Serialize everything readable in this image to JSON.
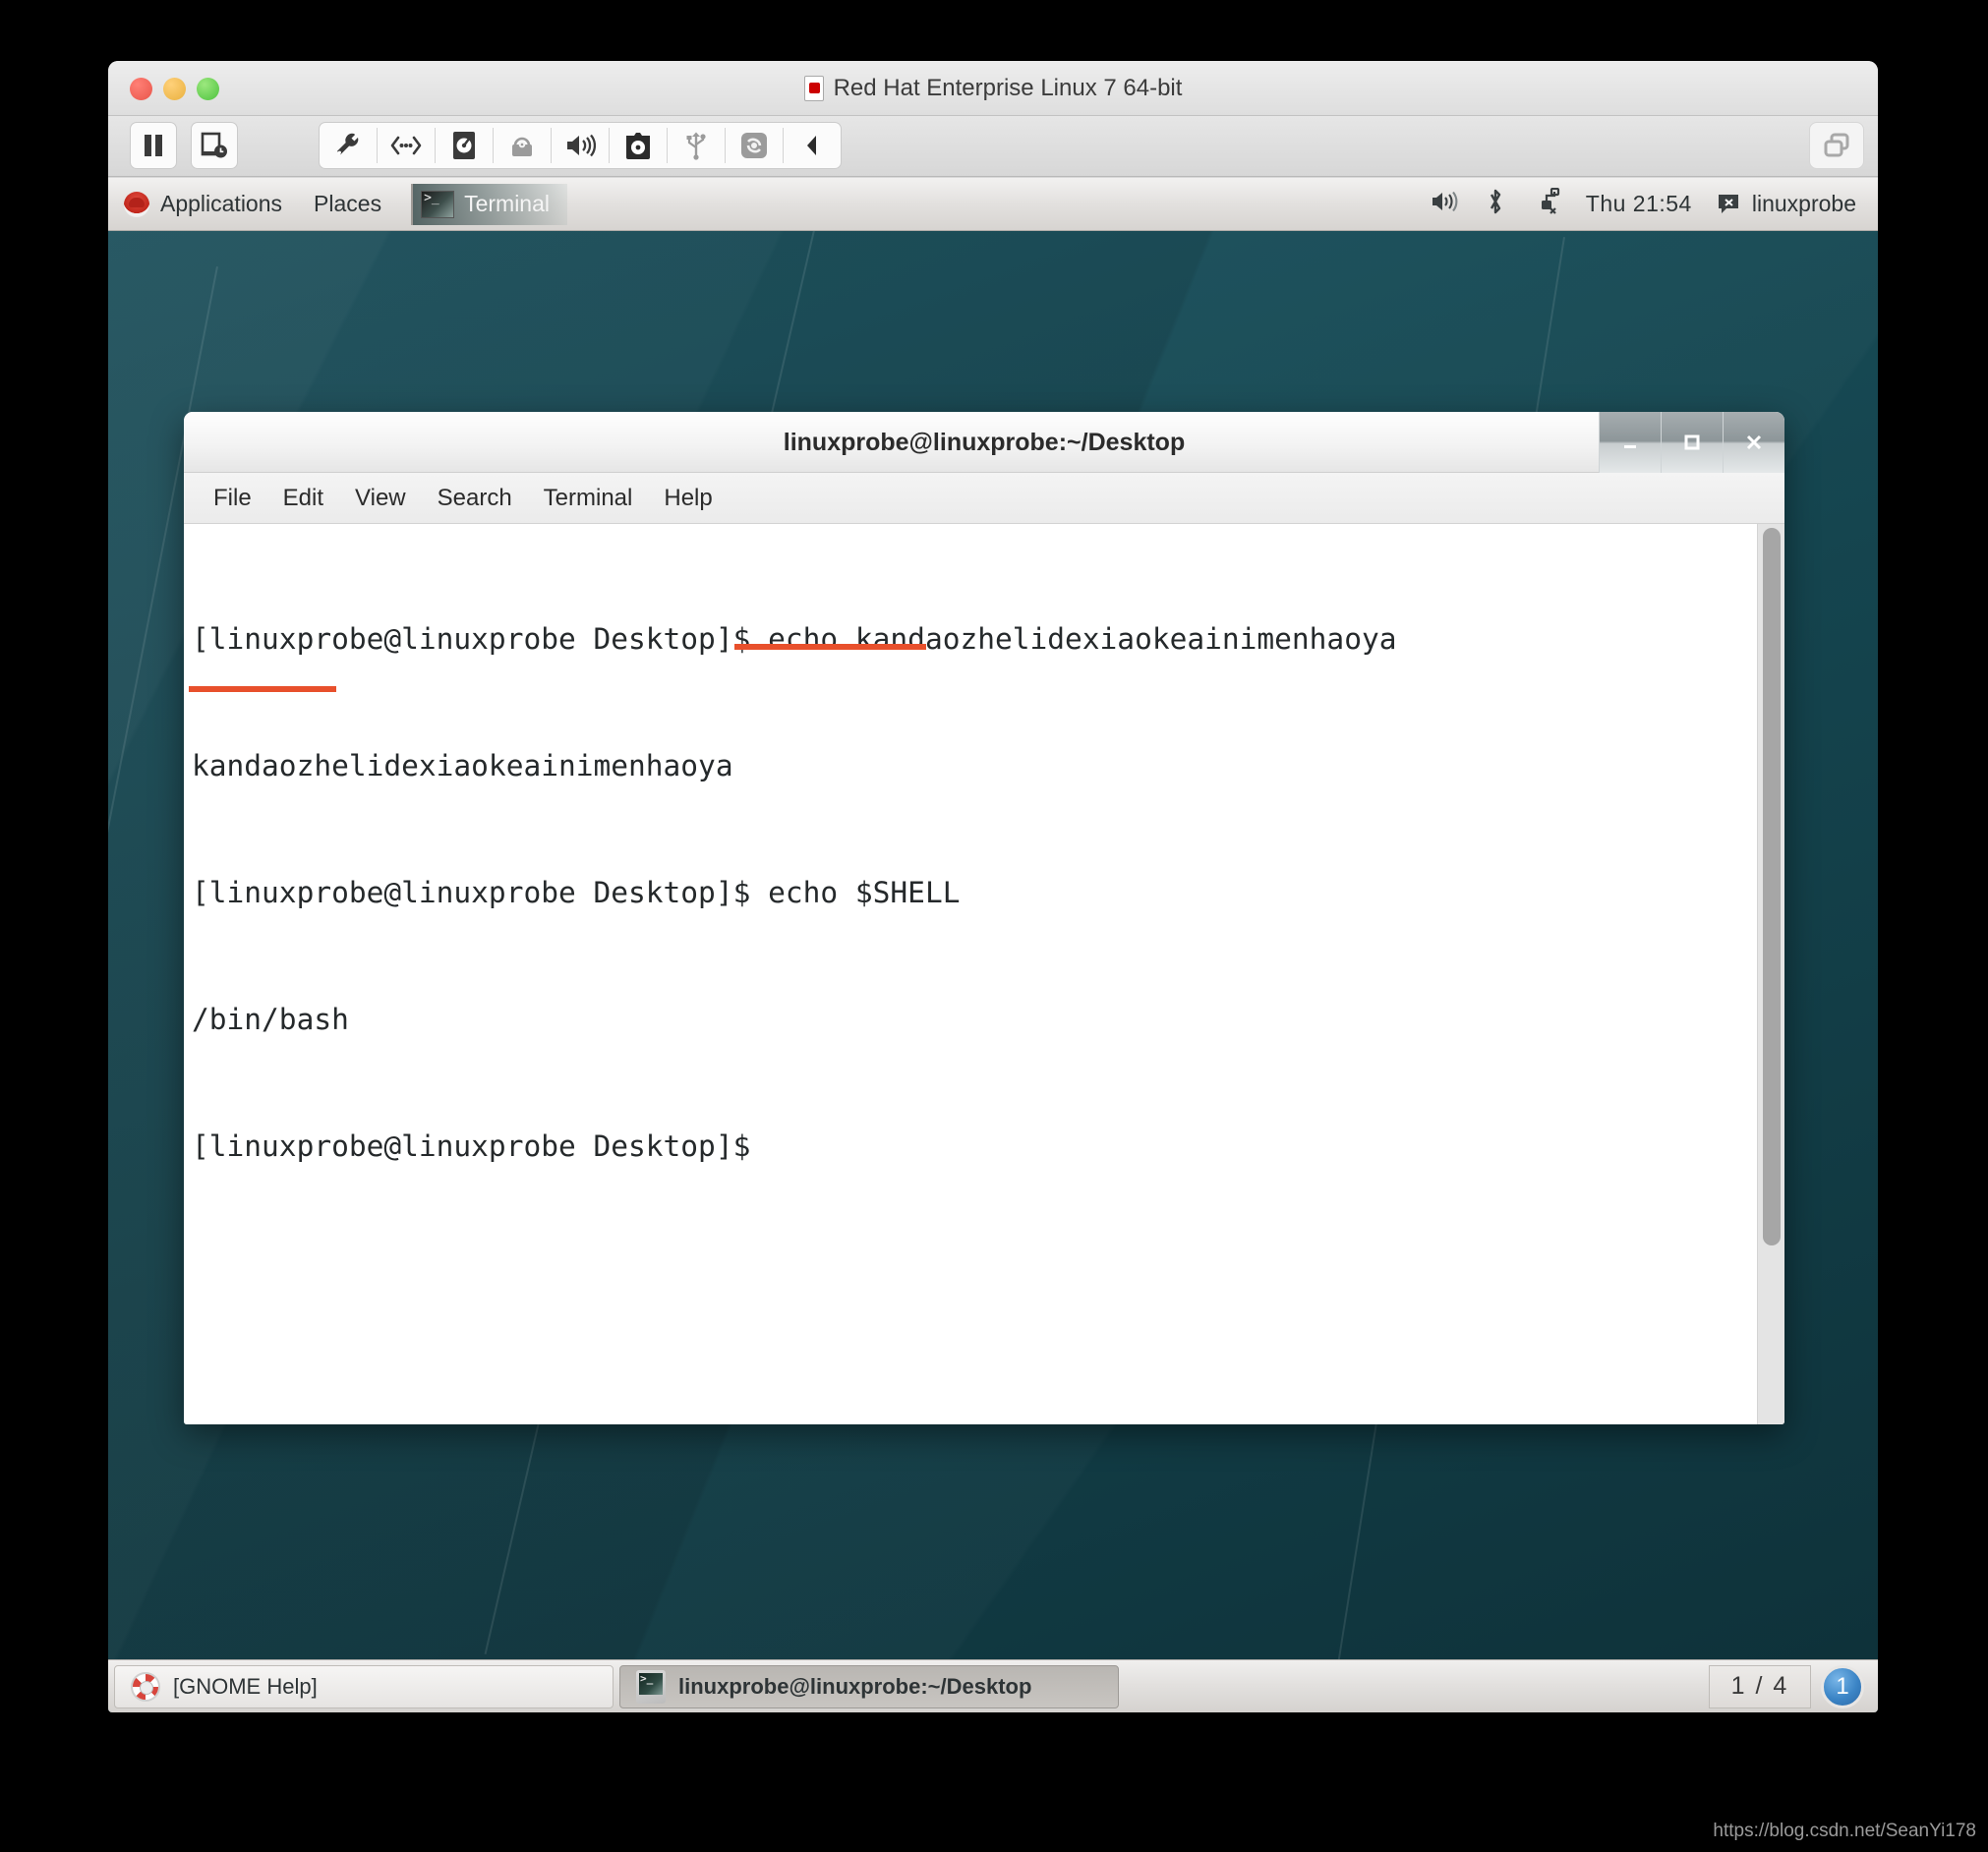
{
  "vm": {
    "title": "Red Hat Enterprise Linux 7 64-bit",
    "toolbar": {
      "pause_label": "pause",
      "snapshot_label": "snapshot",
      "icons": [
        "settings-wrench-icon",
        "network-icon",
        "hard-disk-icon",
        "printer-icon",
        "sound-icon",
        "cd-drive-icon",
        "usb-icon",
        "shared-folders-icon",
        "collapse-arrow-icon"
      ],
      "fullscreen_label": "unity-view-icon"
    }
  },
  "gnome_panel": {
    "applications": "Applications",
    "places": "Places",
    "active_task": "Terminal",
    "clock": "Thu 21:54",
    "user": "linuxprobe",
    "status_icons": [
      "volume-icon",
      "bluetooth-icon",
      "network-disconnected-icon"
    ]
  },
  "desktop": {
    "folder_label": ""
  },
  "terminal": {
    "title": "linuxprobe@linuxprobe:~/Desktop",
    "menu": [
      "File",
      "Edit",
      "View",
      "Search",
      "Terminal",
      "Help"
    ],
    "window_buttons": [
      "minimize",
      "maximize",
      "close"
    ],
    "lines": [
      "[linuxprobe@linuxprobe Desktop]$ echo kandaozhelidexiaokeainimenhaoya",
      "kandaozhelidexiaokeainimenhaoya",
      "[linuxprobe@linuxprobe Desktop]$ echo $SHELL",
      "/bin/bash",
      "[linuxprobe@linuxprobe Desktop]$"
    ],
    "highlight_color": "#e8502c"
  },
  "taskbar": {
    "items": [
      {
        "label": "[GNOME Help]",
        "icon": "help-lifering-icon",
        "active": false
      },
      {
        "label": "linuxprobe@linuxprobe:~/Desktop",
        "icon": "terminal-icon",
        "active": true
      }
    ],
    "workspace": "1 / 4",
    "badge": "1"
  },
  "watermark": "https://blog.csdn.net/SeanYi178"
}
